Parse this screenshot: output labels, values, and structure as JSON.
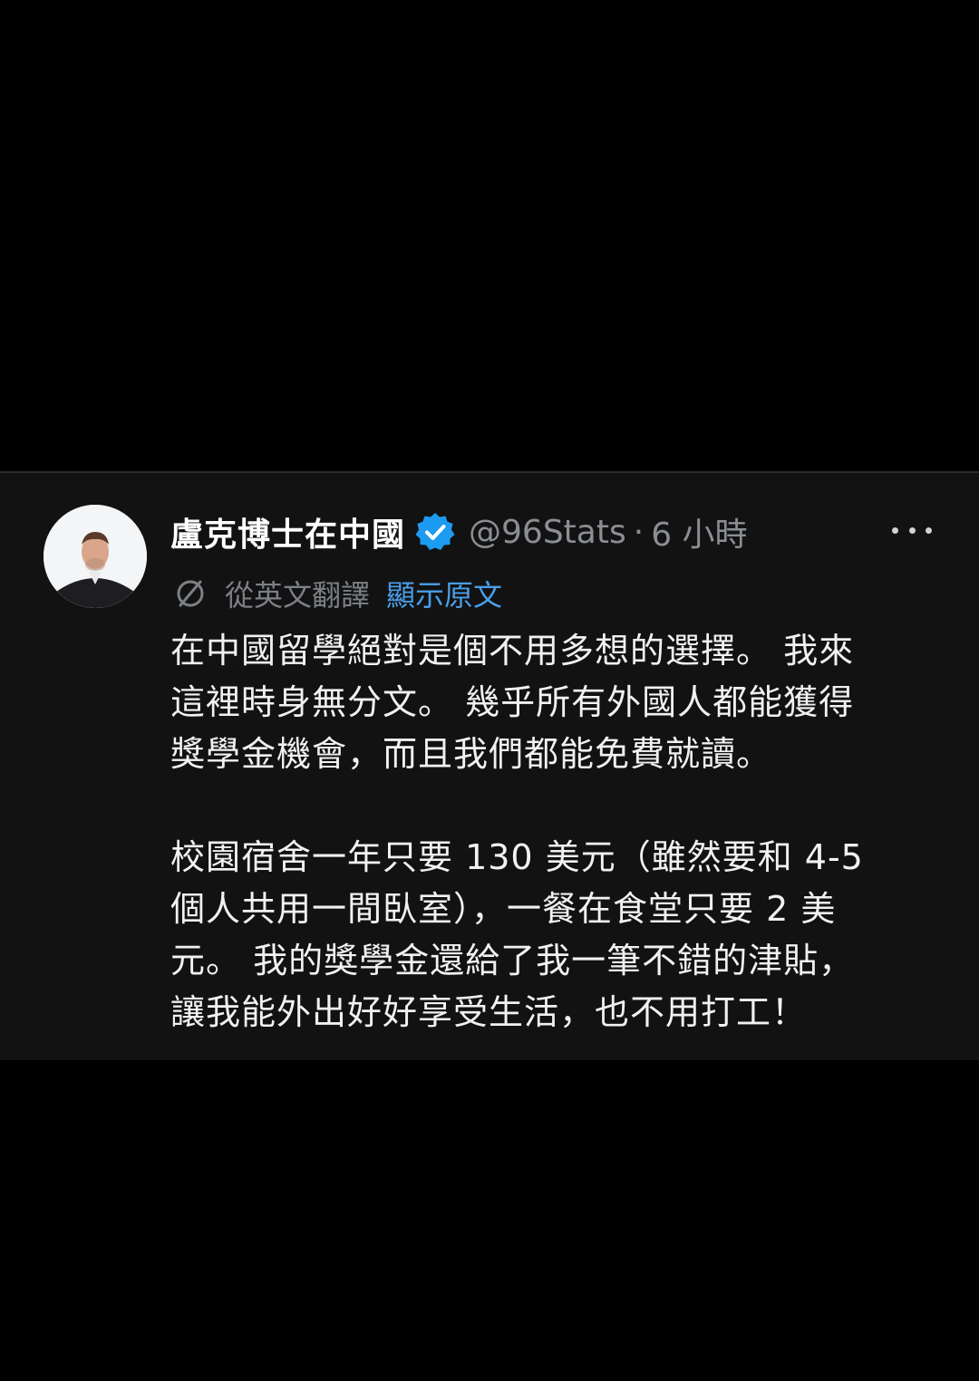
{
  "post": {
    "author": {
      "display_name": "盧克博士在中國",
      "verified": true,
      "handle": "@96Stats",
      "separator": "·",
      "time": "6 小時"
    },
    "translation": {
      "label": "從英文翻譯",
      "show_original": "顯示原文"
    },
    "body": {
      "paragraph1": {
        "line1": "在中國留學絕對是個不用多想的選擇。 我來",
        "line2": "這裡時身無分文。 幾乎所有外國人都能獲得",
        "line3": "獎學金機會，而且我們都能免費就讀。"
      },
      "paragraph2": {
        "line1": "校園宿舍一年只要 130 美元（雖然要和 4-5",
        "line2": "個人共用一間臥室），一餐在食堂只要 2 美",
        "line3": "元。 我的獎學金還給了我一筆不錯的津貼，",
        "line4": "讓我能外出好好享受生活，也不用打工！"
      }
    },
    "colors": {
      "background": "#000000",
      "card": "#121212",
      "text": "#f1f1f1",
      "muted": "#8b8f94",
      "link": "#4a9ee8",
      "verified_badge": "#1d9bf0"
    },
    "icons": {
      "verified": "verified-badge-icon",
      "translate": "translate-icon",
      "more": "more-options-icon"
    }
  }
}
